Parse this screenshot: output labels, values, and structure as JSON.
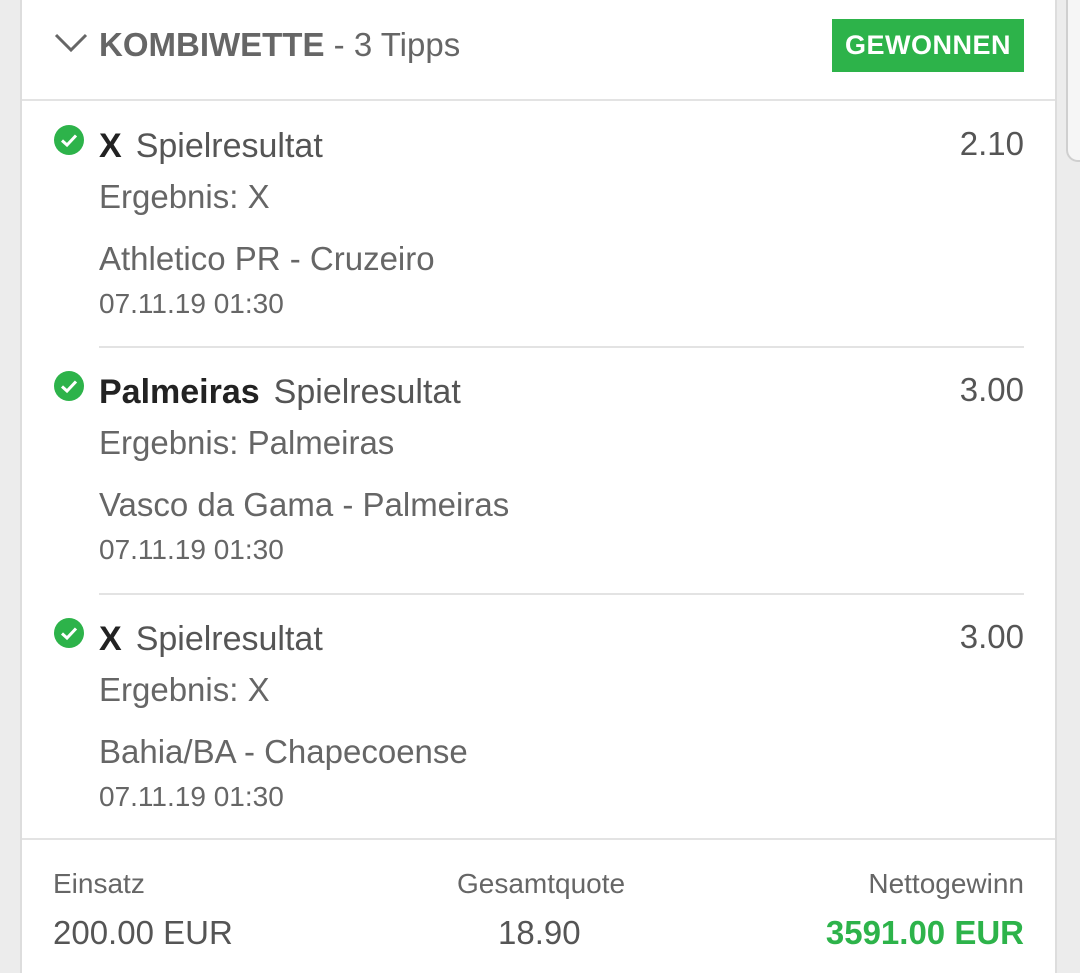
{
  "header": {
    "bet_type": "KOMBIWETTE",
    "tip_count": "- 3 Tipps",
    "status": "GEWONNEN"
  },
  "tips": [
    {
      "selection": "X",
      "market": "Spielresultat",
      "odds": "2.10",
      "result": "Ergebnis: X",
      "match": "Athletico PR - Cruzeiro",
      "datetime": "07.11.19 01:30"
    },
    {
      "selection": "Palmeiras",
      "market": "Spielresultat",
      "odds": "3.00",
      "result": "Ergebnis: Palmeiras",
      "match": "Vasco da Gama - Palmeiras",
      "datetime": "07.11.19 01:30"
    },
    {
      "selection": "X",
      "market": "Spielresultat",
      "odds": "3.00",
      "result": "Ergebnis: X",
      "match": "Bahia/BA - Chapecoense",
      "datetime": "07.11.19 01:30"
    }
  ],
  "footer": {
    "stake_label": "Einsatz",
    "stake_value": "200.00 EUR",
    "total_odds_label": "Gesamtquote",
    "total_odds_value": "18.90",
    "net_win_label": "Nettogewinn",
    "net_win_value": "3591.00 EUR"
  },
  "colors": {
    "accent_green": "#2db34a",
    "text_gray": "#666666",
    "text_dark": "#222222"
  },
  "icons": {
    "collapse": "chevron-down-icon",
    "tip_status": "check-circle-icon"
  }
}
